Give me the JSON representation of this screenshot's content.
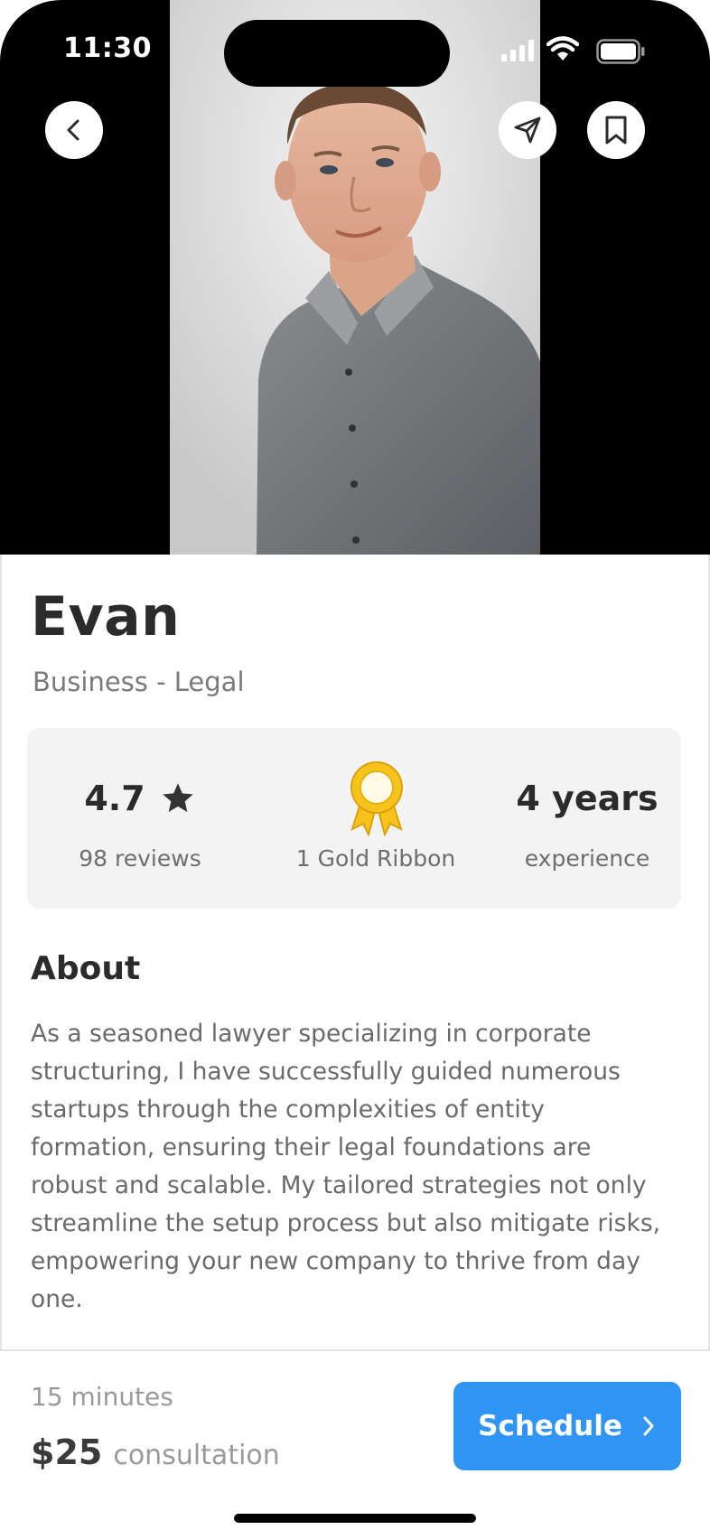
{
  "status": {
    "time": "11:30",
    "icons": [
      "cellular-signal-icon",
      "wifi-icon",
      "battery-icon"
    ]
  },
  "hero": {
    "photo": "profile-photo",
    "buttons": {
      "back": "chevron-left-icon",
      "share": "paper-plane-icon",
      "bookmark": "bookmark-icon"
    }
  },
  "profile": {
    "name": "Evan",
    "category": "Business - Legal"
  },
  "stats": {
    "rating": "4.7",
    "rating_icon": "star-icon",
    "reviews": "98 reviews",
    "ribbon_icon": "gold-ribbon-icon",
    "ribbon": "1 Gold Ribbon",
    "years": "4 years",
    "years_label": "experience"
  },
  "about": {
    "title": "About",
    "text": "As a seasoned lawyer specializing in corporate structuring, I have successfully guided numerous startups through the complexities of entity formation, ensuring their legal foundations are robust and scalable. My tailored strategies not only streamline the setup process but also mitigate risks, empowering your new company to thrive from day one."
  },
  "booking": {
    "duration": "15 minutes",
    "price": "$25",
    "price_label": "consultation",
    "button_label": "Schedule",
    "button_icon": "chevron-right-icon"
  },
  "colors": {
    "accent": "#3095f2",
    "stats_bg": "#f3f3f3",
    "ribbon": "#f6c21c"
  }
}
